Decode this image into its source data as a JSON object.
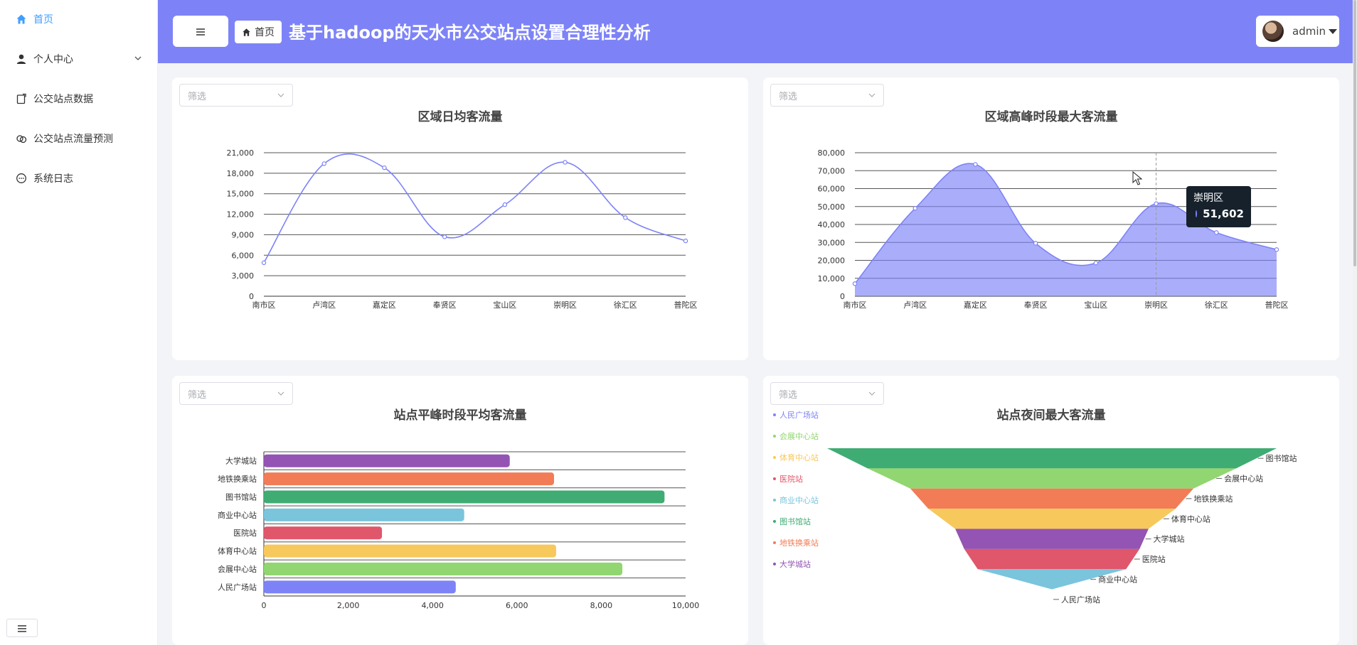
{
  "sidebar": {
    "items": [
      {
        "label": "首页",
        "icon": "home-icon",
        "active": true
      },
      {
        "label": "个人中心",
        "icon": "user-icon",
        "has_children": true
      },
      {
        "label": "公交站点数据",
        "icon": "document-icon"
      },
      {
        "label": "公交站点流量预测",
        "icon": "link-icon"
      },
      {
        "label": "系统日志",
        "icon": "chat-icon"
      }
    ]
  },
  "header": {
    "breadcrumb": "首页",
    "title": "基于hadoop的天水市公交站点设置合理性分析",
    "user": "admin"
  },
  "filters": {
    "placeholder": "筛选"
  },
  "colors": {
    "accent": "#7d83f7",
    "active": "#409eff"
  },
  "chart_data": [
    {
      "type": "line",
      "title": "区域日均客流量",
      "categories": [
        "南市区",
        "卢湾区",
        "嘉定区",
        "奉贤区",
        "宝山区",
        "崇明区",
        "徐汇区",
        "普陀区"
      ],
      "values": [
        4900,
        19400,
        18800,
        8700,
        13400,
        19600,
        11500,
        8100
      ],
      "ylim": [
        0,
        21000
      ],
      "yticks": [
        0,
        3000,
        6000,
        9000,
        12000,
        15000,
        18000,
        21000
      ],
      "smooth": true,
      "color": "#7d83f7"
    },
    {
      "type": "area",
      "title": "区域高峰时段最大客流量",
      "categories": [
        "南市区",
        "卢湾区",
        "嘉定区",
        "奉贤区",
        "宝山区",
        "崇明区",
        "徐汇区",
        "普陀区"
      ],
      "values": [
        7000,
        49000,
        73500,
        29500,
        18500,
        51602,
        35500,
        26000
      ],
      "ylim": [
        0,
        80000
      ],
      "yticks": [
        0,
        10000,
        20000,
        30000,
        40000,
        50000,
        60000,
        70000,
        80000
      ],
      "smooth": true,
      "color": "#7d83f7",
      "tooltip": {
        "category": "崇明区",
        "value": "51,602"
      }
    },
    {
      "type": "bar",
      "orientation": "horizontal",
      "title": "站点平峰时段平均客流量",
      "categories": [
        "人民广场站",
        "会展中心站",
        "体育中心站",
        "医院站",
        "商业中心站",
        "图书馆站",
        "地铁换乘站",
        "大学城站"
      ],
      "values": [
        4550,
        8500,
        6930,
        2800,
        4750,
        9500,
        6880,
        5830
      ],
      "colors": [
        "#7d83f7",
        "#91d670",
        "#f7c85c",
        "#e0566b",
        "#7ac4dc",
        "#3fac73",
        "#f27c56",
        "#9354b3"
      ],
      "xlim": [
        0,
        10000
      ],
      "xticks": [
        0,
        2000,
        4000,
        6000,
        8000,
        10000
      ]
    },
    {
      "type": "funnel",
      "title": "站点夜间最大客流量",
      "legend": [
        {
          "name": "人民广场站",
          "color": "#7d83f7"
        },
        {
          "name": "会展中心站",
          "color": "#91d670"
        },
        {
          "name": "体育中心站",
          "color": "#f7c85c"
        },
        {
          "name": "医院站",
          "color": "#e0566b"
        },
        {
          "name": "商业中心站",
          "color": "#7ac4dc"
        },
        {
          "name": "图书馆站",
          "color": "#3fac73"
        },
        {
          "name": "地铁换乘站",
          "color": "#f27c56"
        },
        {
          "name": "大学城站",
          "color": "#9354b3"
        }
      ],
      "order_top_to_bottom": [
        "图书馆站",
        "会展中心站",
        "地铁换乘站",
        "体育中心站",
        "大学城站",
        "医院站",
        "商业中心站",
        "人民广场站"
      ],
      "relative_values": [
        100,
        82,
        63,
        55,
        43,
        39,
        33,
        0
      ]
    }
  ]
}
